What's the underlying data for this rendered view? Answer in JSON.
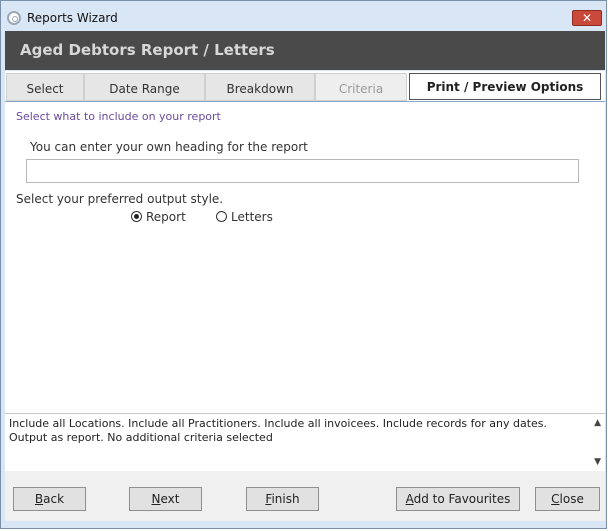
{
  "window": {
    "title": "Reports Wizard",
    "close_symbol": "✕"
  },
  "header": {
    "title": "Aged Debtors Report / Letters"
  },
  "tabs": [
    {
      "label": "Select",
      "state": "normal"
    },
    {
      "label": "Date Range",
      "state": "normal"
    },
    {
      "label": "Breakdown",
      "state": "normal"
    },
    {
      "label": "Criteria",
      "state": "disabled"
    },
    {
      "label": "Print / Preview Options",
      "state": "active"
    }
  ],
  "main": {
    "subtitle": "Select what to include on your report",
    "heading_label": "You can enter your own heading for the report",
    "heading_value": "",
    "style_label": "Select your preferred output style.",
    "options": [
      {
        "label": "Report",
        "checked": true
      },
      {
        "label": "Letters",
        "checked": false
      }
    ]
  },
  "summary": {
    "text": "Include all Locations. Include all Practitioners. Include all invoicees. Include records for any dates. Output as report. No additional criteria selected",
    "scroll_up": "▲",
    "scroll_down": "▼"
  },
  "buttons": {
    "back": {
      "accel": "B",
      "rest": "ack"
    },
    "next": {
      "accel": "N",
      "rest": "ext"
    },
    "finish": {
      "accel": "F",
      "rest": "inish"
    },
    "favourites": {
      "accel": "A",
      "rest": "dd to Favourites"
    },
    "close": {
      "accel": "C",
      "rest": "lose"
    }
  },
  "colors": {
    "header_bg": "#4a4a4a",
    "subtitle": "#6a4aa0",
    "close_button": "#c9493a"
  }
}
